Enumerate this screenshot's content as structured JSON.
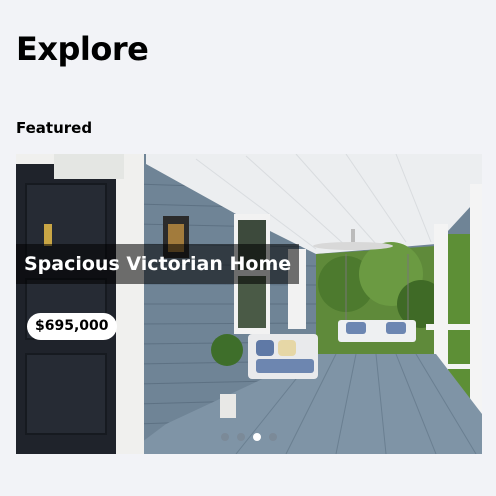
{
  "header": {
    "title": "Explore"
  },
  "featured": {
    "section_title": "Featured",
    "listing": {
      "title": "Spacious Victorian Home",
      "price": "$695,000"
    },
    "carousel": {
      "slide_count": 4,
      "active_index": 2
    }
  }
}
